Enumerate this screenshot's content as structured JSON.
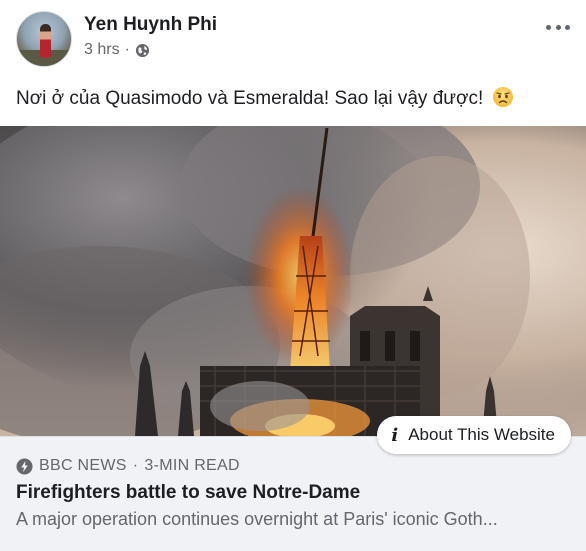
{
  "post": {
    "author_name": "Yen Huynh Phi",
    "time": "3 hrs",
    "separator": "·",
    "text": "Nơi ở của Quasimodo và Esmeralda! Sao lại vậy được!",
    "emoji": "worried-face-icon"
  },
  "link": {
    "about_label": "About This Website",
    "source": "BBC NEWS",
    "source_separator": "·",
    "read_time": "3-MIN READ",
    "title": "Firefighters battle to save Notre-Dame",
    "description": "A major operation continues overnight at Paris' iconic Goth..."
  },
  "icons": {
    "globe": "globe-icon",
    "more": "more-options-icon",
    "info": "info-icon",
    "lightning": "lightning-icon"
  },
  "colors": {
    "text_primary": "#1c1e21",
    "text_secondary": "#65676b",
    "footer_bg": "#f0f2f5"
  }
}
